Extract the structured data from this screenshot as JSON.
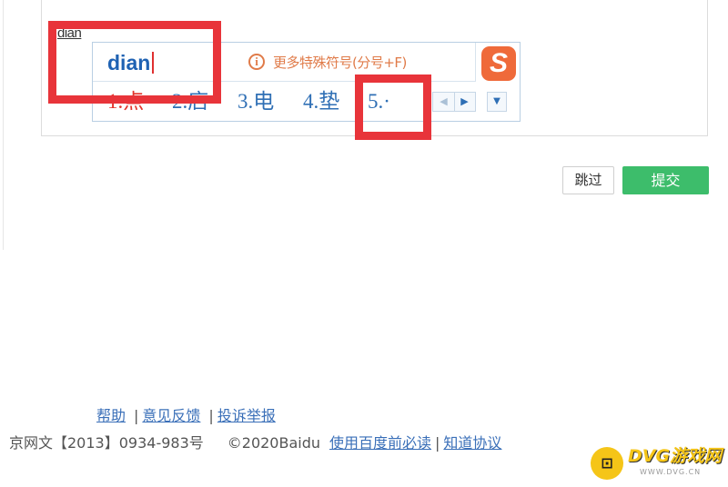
{
  "editor": {
    "typed_text": "dian"
  },
  "ime": {
    "input": "dian",
    "hint_icon": "info-circle-icon",
    "hint_text": "更多特殊符号(分号+F)",
    "logo_letter": "S",
    "logo_icon": "sogou-logo",
    "candidates": [
      "1.点",
      "2.店",
      "3.电",
      "4.垫",
      "5.·"
    ],
    "prev_glyph": "◀",
    "next_glyph": "▶",
    "expand_glyph": "▼",
    "colors": {
      "first_candidate": "#e2332a",
      "candidates": "#2f6fb5",
      "hint": "#e07b49",
      "input": "#1f62b3"
    }
  },
  "actions": {
    "skip": "跳过",
    "submit": "提交"
  },
  "footer": {
    "help": "帮助",
    "feedback": "意见反馈",
    "report": "投诉举报",
    "separator": "|",
    "license": "京网文【2013】0934-983号",
    "copyright": "©2020Baidu",
    "must_read": "使用百度前必读",
    "agreement": "知道协议"
  },
  "watermark": {
    "title": "DVG游戏网",
    "subtitle": "WWW.DVG.CN",
    "icon": "gamepad-icon"
  },
  "annotation_color": "#e8343a"
}
